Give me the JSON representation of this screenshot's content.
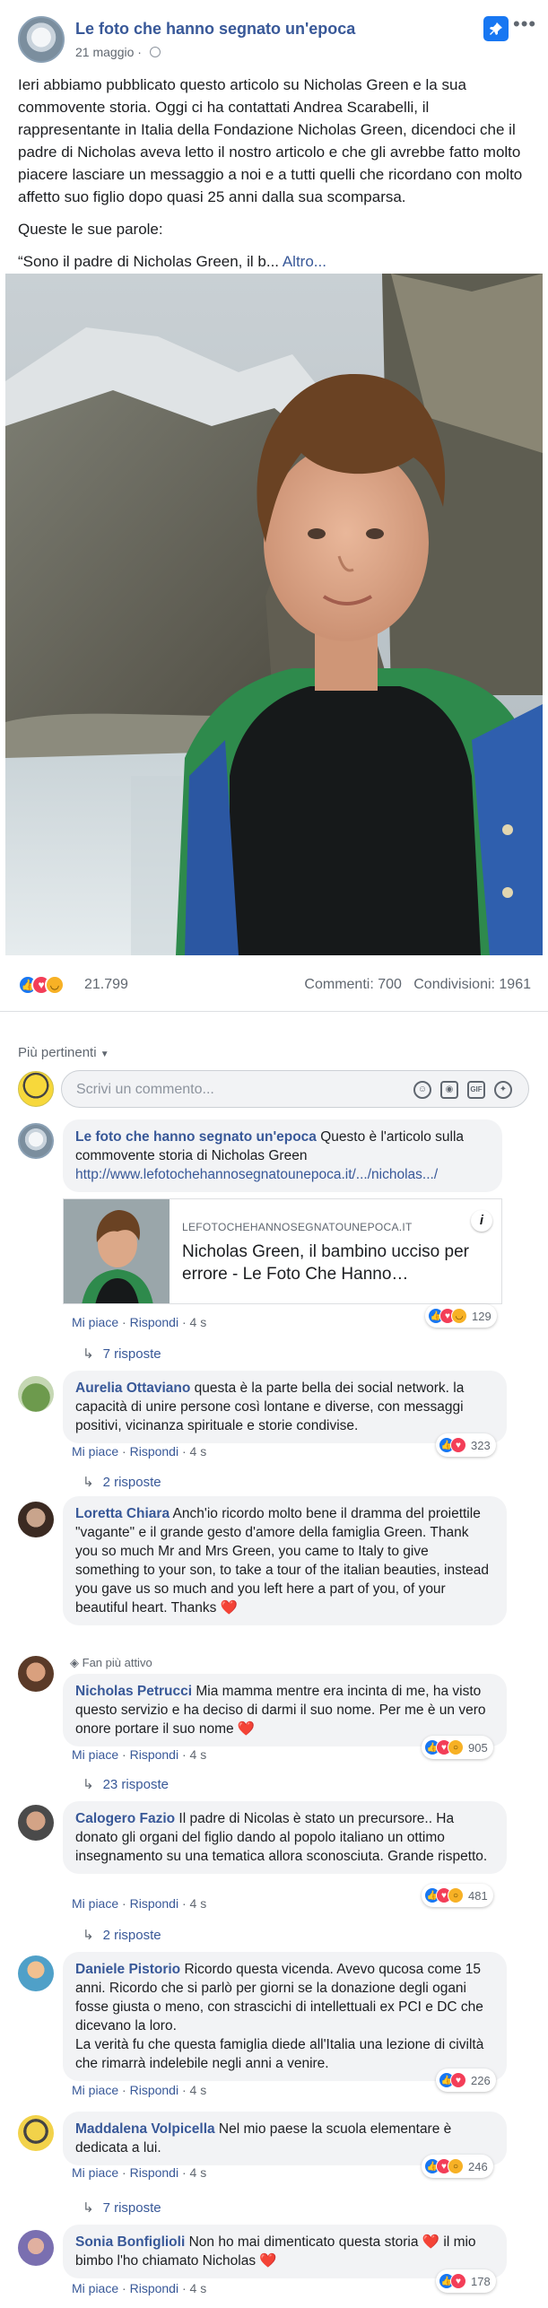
{
  "post": {
    "page_name": "Le foto che hanno segnato un'epoca",
    "date": "21 maggio",
    "dot": "·",
    "paragraph1": "Ieri abbiamo pubblicato questo articolo su Nicholas Green e la sua commovente storia. Oggi ci ha contattati Andrea Scarabelli, il rappresentante in Italia della Fondazione Nicholas Green, dicendoci che il padre di Nicholas aveva letto il nostro articolo e che gli avrebbe fatto molto piacere lasciare un messaggio a noi e a tutti quelli che ricordano con molto affetto suo figlio dopo quasi 25 anni dalla sua scomparsa.",
    "paragraph2": "Queste le sue parole:",
    "quote": "“Sono il padre di Nicholas Green, il b...",
    "more": "Altro...",
    "reactions_count": "21.799",
    "comments_count": "Commenti: 700",
    "shares_count": "Condivisioni: 1961",
    "icons": {
      "pin": "pin-icon",
      "menu": "more-dots-icon",
      "privacy": "globe-icon"
    }
  },
  "comments_section": {
    "filter_label": "Più pertinenti",
    "composer_placeholder": "Scrivi un commento...",
    "composer_icons": [
      "emoji-icon",
      "camera-icon",
      "gif-icon",
      "sticker-icon"
    ],
    "like_label": "Mi piace",
    "reply_label": "Rispondi",
    "separator": "·",
    "fan_badge": "Fan più attivo"
  },
  "link_preview": {
    "domain": "LEFOTOCHEHANNOSEGNATOUNEPOCA.IT",
    "title": "Nicholas Green, il bambino ucciso per errore - Le Foto Che Hanno…",
    "info": "i"
  },
  "comments": [
    {
      "name": "Le foto che hanno segnato un'epoca",
      "text": " Questo è l'articolo sulla commovente storia di Nicholas Green ",
      "link": "http://www.lefotochehannosegnatounepoca.it/.../nicholas.../",
      "time": "4 s",
      "reactions": "129",
      "replies": "7 risposte"
    },
    {
      "name": "Aurelia Ottaviano",
      "text": " questa è la parte bella dei social network. la capacità di unire persone così lontane e diverse, con messaggi positivi, vicinanza spirituale e storie condivise.",
      "time": "4 s",
      "reactions": "323",
      "replies": "2 risposte"
    },
    {
      "name": "Loretta Chiara",
      "text": " Anch'io ricordo molto bene il dramma del proiettile \"vagante\" e il grande gesto d'amore della famiglia Green. Thank you so much Mr and Mrs Green, you came to Italy to give something to your son, to take a tour of the italian beauties, instead you gave us so much and you left here a part of you, of your beautiful heart. Thanks ❤️"
    },
    {
      "name": "Nicholas Petrucci",
      "text": " Mia mamma mentre era incinta di me, ha visto questo servizio e ha deciso di darmi il suo nome. Per me è un vero onore portare il suo nome ❤️",
      "time": "4 s",
      "reactions": "905",
      "replies": "23 risposte"
    },
    {
      "name": "Calogero Fazio",
      "text": " Il padre di Nicolas è stato un precursore.. Ha donato gli organi del figlio dando al popolo italiano un ottimo insegnamento su una tematica allora sconosciuta. Grande rispetto.",
      "time": "4 s",
      "reactions": "481",
      "replies": "2 risposte"
    },
    {
      "name": "Daniele Pistorio",
      "text": " Ricordo questa vicenda. Avevo qucosa come 15 anni. Ricordo che si parlò per giorni se la donazione degli ogani fosse giusta o meno, con strascichi di intellettuali ex PCI e DC che dicevano la loro.",
      "text2": "La verità fu che questa famiglia diede all'Italia una lezione di civiltà che rimarrà indelebile negli anni a venire.",
      "time": "4 s",
      "reactions": "226"
    },
    {
      "name": "Maddalena Volpicella",
      "text": " Nel mio paese la scuola elementare è dedicata a lui.",
      "time": "4 s",
      "reactions": "246",
      "replies": "7 risposte"
    },
    {
      "name": "Sonia Bonfiglioli",
      "text": " Non ho mai dimenticato questa storia ❤️ il mio bimbo l'ho chiamato Nicholas ❤️",
      "time": "4 s",
      "reactions": "178"
    }
  ],
  "colors": {
    "link": "#385898",
    "like": "#1877f2",
    "love": "#f33e58",
    "haha": "#f7b125",
    "muted": "#606770"
  }
}
